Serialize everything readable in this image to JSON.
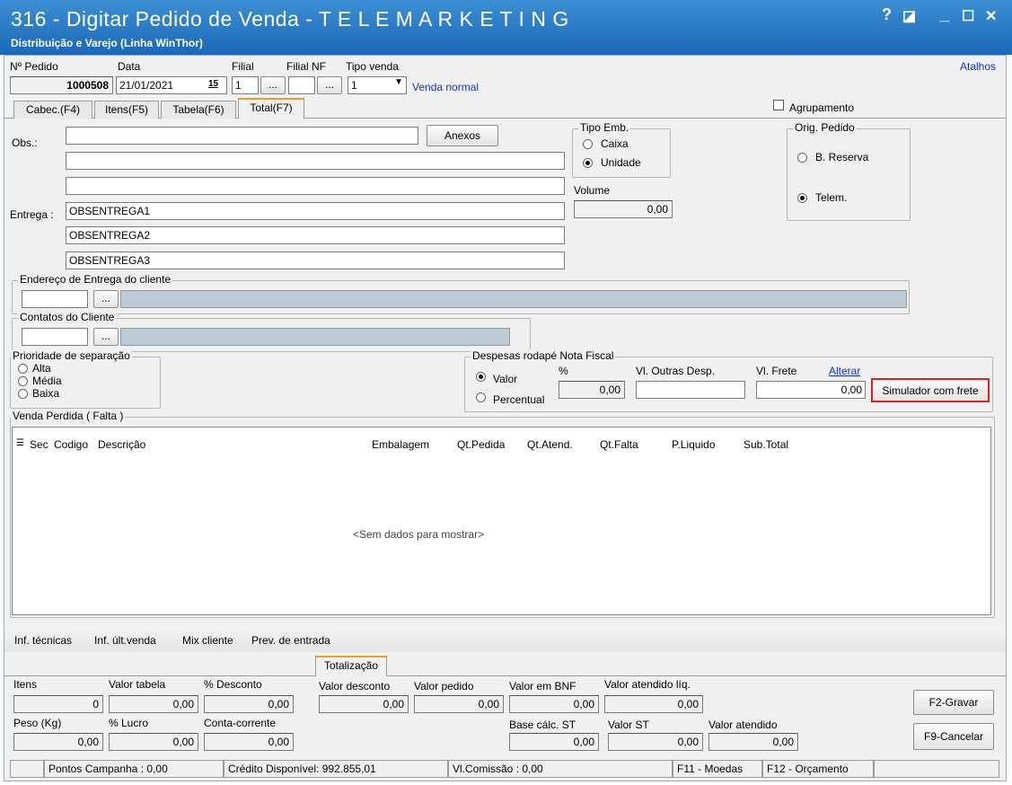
{
  "window": {
    "title": "316 - Digitar Pedido de Venda - T E L E M A R K E T I N G",
    "subtitle": "Distribuição e Varejo (Linha WinThor)",
    "help": "?",
    "restore": "◪",
    "minimize": "_",
    "maximize": "☐",
    "close": "✕"
  },
  "header": {
    "pedido_label": "Nº Pedido",
    "pedido_value": "1000508",
    "data_label": "Data",
    "data_value": "21/01/2021",
    "calendar": "15",
    "filial_label": "Filial",
    "filial_value": "1",
    "filialnf_label": "Filial NF",
    "filialnf_value": "",
    "tipovenda_label": "Tipo venda",
    "tipovenda_value": "1",
    "tipovenda_desc": "Venda normal",
    "ellipsis": "...",
    "atalhos": "Atalhos"
  },
  "tabs": [
    "Cabec.(F4)",
    "Itens(F5)",
    "Tabela(F6)",
    "Total(F7)"
  ],
  "agrupamento": "Agrupamento",
  "obs": {
    "label": "Obs.:",
    "anexos": "Anexos",
    "line1": "",
    "line2": "",
    "line3": ""
  },
  "entrega": {
    "label": "Entrega :",
    "line1": "OBSENTREGA1",
    "line2": "OBSENTREGA2",
    "line3": "OBSENTREGA3"
  },
  "tipo_emb": {
    "title": "Tipo Emb.",
    "caixa": "Caixa",
    "unidade": "Unidade"
  },
  "volume": {
    "label": "Volume",
    "value": "0,00"
  },
  "orig_pedido": {
    "title": "Orig. Pedido",
    "reserva": "B. Reserva",
    "telem": "Telem."
  },
  "endereco": {
    "title": "Endereço de Entrega do cliente",
    "ellipsis": "..."
  },
  "contatos": {
    "title": "Contatos do Cliente",
    "ellipsis": "..."
  },
  "prioridade": {
    "title": "Prioridade de separação",
    "alta": "Alta",
    "media": "Média",
    "baixa": "Baixa"
  },
  "despesas": {
    "title": "Despesas rodapé Nota Fiscal",
    "valor": "Valor",
    "percentual": "Percentual",
    "pct_label": "%",
    "pct_value": "0,00",
    "outras_label": "Vl. Outras Desp.",
    "outras_value": "",
    "frete_label": "Vl. Frete",
    "frete_value": "0,00",
    "alterar": "Alterar",
    "simulador": "Simulador com frete"
  },
  "venda_perdida": {
    "title": "Venda Perdida ( Falta )",
    "columns": [
      "Sec",
      "Codigo",
      "Descrição",
      "Embalagem",
      "Qt.Pedida",
      "Qt.Atend.",
      "Qt.Falta",
      "P.Liquido",
      "Sub.Total"
    ],
    "empty": "<Sem dados para mostrar>"
  },
  "links": [
    "Inf. técnicas",
    "Inf. últ.venda",
    "Mix cliente",
    "Prev. de entrada"
  ],
  "totalizacao": {
    "tab": "Totalização",
    "itens_label": "Itens",
    "itens": "0",
    "valor_tabela_label": "Valor tabela",
    "valor_tabela": "0,00",
    "desconto_label": "% Desconto",
    "desconto": "0,00",
    "valor_desconto_label": "Valor desconto",
    "valor_desconto": "0,00",
    "valor_pedido_label": "Valor pedido",
    "valor_pedido": "0,00",
    "valor_bnf_label": "Valor em BNF",
    "valor_bnf": "0,00",
    "valor_atendido_liq_label": "Valor atendido líq.",
    "valor_atendido_liq": "0,00",
    "peso_label": "Peso (Kg)",
    "peso": "0,00",
    "lucro_label": "% Lucro",
    "lucro": "0,00",
    "conta_label": "Conta-corrente",
    "conta": "0,00",
    "base_st_label": "Base cálc. ST",
    "base_st": "0,00",
    "valor_st_label": "Valor ST",
    "valor_st": "0,00",
    "valor_atendido_label": "Valor atendido",
    "valor_atendido": "0,00"
  },
  "buttons": {
    "gravar": "F2-Gravar",
    "cancelar": "F9-Cancelar"
  },
  "status": {
    "pontos": "Pontos Campanha : 0,00",
    "credito": "Crédito Disponível: 992.855,01",
    "comissao": "Vl.Comissão : 0,00",
    "moedas": "F11 - Moedas",
    "orcamento": "F12 - Orçamento"
  }
}
